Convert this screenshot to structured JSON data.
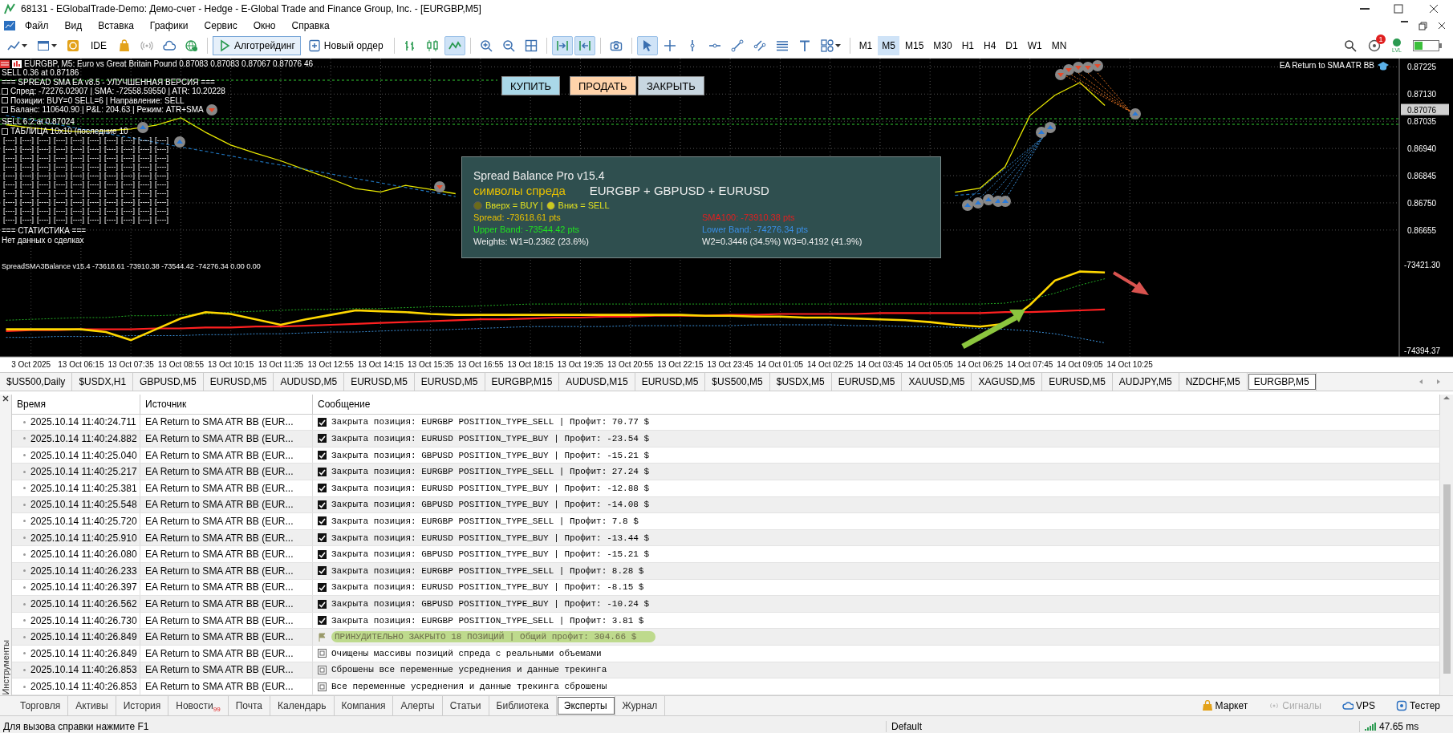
{
  "window": {
    "title": "68131 - EGlobalTrade-Demo: Демо-счет - Hedge - E-Global Trade and Finance Group, Inc. - [EURGBP,M5]"
  },
  "menu": [
    "Файл",
    "Вид",
    "Вставка",
    "Графики",
    "Сервис",
    "Окно",
    "Справка"
  ],
  "toolbar": {
    "ide": "IDE",
    "algo_trading": {
      "label": "Алготрейдинг",
      "on": true
    },
    "new_order": "Новый ордер",
    "tools": [
      {
        "selected": false
      },
      {
        "selected": false
      },
      {
        "selected": false
      },
      {
        "selected": false
      },
      {
        "selected": false
      },
      {
        "selected": false
      },
      {
        "selected": false
      },
      {
        "selected": false
      },
      {
        "selected": false
      },
      {
        "selected": true
      },
      {
        "selected": false
      },
      {
        "selected": false
      },
      {
        "selected": false
      },
      {
        "selected": true
      },
      {
        "selected": true
      },
      {
        "selected": false
      },
      {
        "selected": true
      },
      {
        "selected": false
      },
      {
        "selected": false
      },
      {
        "selected": false
      },
      {
        "selected": false
      },
      {
        "selected": false
      },
      {
        "selected": false
      },
      {
        "selected": false
      },
      {
        "selected": false
      }
    ],
    "timeframes": [
      {
        "label": "M1",
        "selected": false
      },
      {
        "label": "M5",
        "selected": true
      },
      {
        "label": "M15",
        "selected": false
      },
      {
        "label": "M30",
        "selected": false
      },
      {
        "label": "H1",
        "selected": false
      },
      {
        "label": "H4",
        "selected": false
      },
      {
        "label": "D1",
        "selected": false
      },
      {
        "label": "W1",
        "selected": false
      },
      {
        "label": "MN",
        "selected": false
      }
    ],
    "notification_badge": "1",
    "level_label": "LVL"
  },
  "chart": {
    "header": "EURGBP, M5:  Euro vs Great Britain Pound  0.87083 0.87083 0.87067 0.87076  46",
    "info_lines": [
      {
        "kind": "plain",
        "text": "SELL 0.36 at 0.87186"
      },
      {
        "kind": "plain",
        "text": "=== SPREAD SMA EA v8.5 - УЛУЧШЕННАЯ ВЕРСИЯ ==="
      },
      {
        "kind": "bullet",
        "text": "Спред: -72276.02907 | SMA: -72558.59550 | ATR: 10.20228"
      },
      {
        "kind": "bullet",
        "text": "Позиции: BUY=0 SELL=6 | Направление: SELL"
      },
      {
        "kind": "bullet",
        "text": "Баланс: 110640.90 | P&L: 204.63 | Режим: ATR+SMA"
      }
    ],
    "sell_label": "SELL 6.2 at 0.87024",
    "table_title": "ТАБЛИЦА 10x10 (последние 10",
    "table_rows": [
      [
        "[----]",
        "[----]",
        "[----]",
        "[----]",
        "[----]",
        "[----]",
        "[----]",
        "[----]",
        "[----]",
        "[----]"
      ],
      [
        "[----]",
        "[----]",
        "[----]",
        "[----]",
        "[----]",
        "[----]",
        "[----]",
        "[----]",
        "[----]",
        "[----]"
      ],
      [
        "[----]",
        "[----]",
        "[----]",
        "[----]",
        "[----]",
        "[----]",
        "[----]",
        "[----]",
        "[----]",
        "[----]"
      ],
      [
        "[----]",
        "[----]",
        "[----]",
        "[----]",
        "[----]",
        "[----]",
        "[----]",
        "[----]",
        "[----]",
        "[----]"
      ],
      [
        "[----]",
        "[----]",
        "[----]",
        "[----]",
        "[----]",
        "[----]",
        "[----]",
        "[----]",
        "[----]",
        "[----]"
      ],
      [
        "[----]",
        "[----]",
        "[----]",
        "[----]",
        "[----]",
        "[----]",
        "[----]",
        "[----]",
        "[----]",
        "[----]"
      ],
      [
        "[----]",
        "[----]",
        "[----]",
        "[----]",
        "[----]",
        "[----]",
        "[----]",
        "[----]",
        "[----]",
        "[----]"
      ],
      [
        "[----]",
        "[----]",
        "[----]",
        "[----]",
        "[----]",
        "[----]",
        "[----]",
        "[----]",
        "[----]",
        "[----]"
      ],
      [
        "[----]",
        "[----]",
        "[----]",
        "[----]",
        "[----]",
        "[----]",
        "[----]",
        "[----]",
        "[----]",
        "[----]"
      ],
      [
        "[----]",
        "[----]",
        "[----]",
        "[----]",
        "[----]",
        "[----]",
        "[----]",
        "[----]",
        "[----]",
        "[----]"
      ]
    ],
    "stats_title": "=== СТАТИСТИКА ===",
    "stats_text": "Нет данных о сделках",
    "buttons": [
      {
        "label": "КУПИТЬ",
        "kind": "buy"
      },
      {
        "label": "ПРОДАТЬ",
        "kind": "sell"
      },
      {
        "label": "ЗАКРЫТЬ",
        "kind": "close"
      }
    ],
    "expert_label": "EA Return to SMA ATR BB",
    "last_price": "0.87076",
    "chart_data": {
      "type": "line",
      "categories": [
        null,
        null,
        null,
        null,
        null,
        null,
        null,
        null,
        null,
        null,
        null,
        null,
        null,
        null,
        null,
        null,
        null,
        null,
        null,
        null,
        null,
        null,
        null,
        null,
        null,
        null,
        null,
        null,
        null,
        null,
        null,
        null,
        null,
        null,
        null,
        null,
        null,
        null,
        null,
        null,
        null,
        null,
        null,
        null,
        null,
        null,
        null,
        null,
        null,
        null,
        null,
        null,
        null,
        null,
        null,
        null
      ],
      "series": [
        {
          "color": "#e8e800",
          "values": [
            0.87023,
            0.87012,
            0.87004,
            0.86998,
            0.87002,
            0.87008,
            0.87021,
            0.87047,
            0.86996,
            0.86952,
            0.86923,
            0.86897,
            0.86865,
            0.86834,
            0.868,
            0.86788,
            0.86811,
            0.86797,
            0.86782,
            null,
            null,
            null,
            null,
            null,
            null,
            null,
            null,
            null,
            null,
            null,
            null,
            null,
            null,
            null,
            null,
            null,
            null,
            null,
            0.86787,
            0.86801,
            0.86876,
            0.87055,
            0.87126,
            0.8717,
            0.8709,
            null,
            null,
            null,
            null,
            null,
            null,
            null,
            null,
            null,
            null,
            null
          ]
        },
        {
          "color": "#1e6fb4",
          "line_style": "dashed",
          "values": [
            0.87055,
            0.8704,
            0.87025,
            0.87008,
            0.86993,
            0.86977,
            0.86961,
            0.86945,
            0.8693,
            0.86914,
            0.86897,
            0.86882,
            0.86867,
            0.86851,
            0.86835,
            0.8682,
            0.86804,
            0.86788,
            0.86772,
            null,
            null,
            null,
            null,
            null,
            null,
            null,
            null,
            null,
            null,
            null,
            null,
            null,
            null,
            null,
            null,
            null,
            null,
            null,
            0.86776,
            0.86782,
            null,
            null,
            null,
            null,
            null,
            null,
            null,
            null,
            null,
            null,
            null,
            null,
            null,
            null,
            null,
            null
          ]
        }
      ],
      "ylim": [
        0.86551,
        0.87254
      ],
      "grid": true,
      "yticks": [
        {
          "value": 0.87225,
          "label": "0.87225"
        },
        {
          "value": 0.8713,
          "label": "0.87130"
        },
        {
          "value": 0.87035,
          "label": "0.87035"
        },
        {
          "value": 0.8694,
          "label": "0.86940"
        },
        {
          "value": 0.86845,
          "label": "0.86845"
        },
        {
          "value": 0.8675,
          "label": "0.86750"
        },
        {
          "value": 0.86655,
          "label": "0.86655"
        }
      ]
    }
  },
  "panel": {
    "title": "Spread Balance Pro v15.4",
    "symbols_label": "символы спреда",
    "symbols": "EURGBP + GBPUSD + EURUSD",
    "legend": [
      {
        "text": "Вверх = BUY |",
        "color": "#6b6b1a"
      },
      {
        "text": "Вниз = SELL",
        "color": "#c8c820"
      }
    ],
    "rows": [
      [
        {
          "text": "Spread: -73618.61 pts",
          "color": "#e8c000"
        },
        {
          "text": "SMA100: -73910.38 pts",
          "color": "#e02020"
        }
      ],
      [
        {
          "text": "Upper Band: -73544.42 pts",
          "color": "#20e020"
        },
        {
          "text": "Lower Band: -74276.34 pts",
          "color": "#3a8fe8"
        }
      ],
      [
        {
          "text": "Weights: W1=0.2362 (23.6%)",
          "color": "#f0f0f0"
        },
        {
          "text": "W2=0.3446 (34.5%) W3=0.4192 (41.9%)",
          "color": "#f0f0f0"
        }
      ]
    ]
  },
  "indicator": {
    "header": "SpreadSMA3Balance v15.4 -73618.61 -73910.38 -73544.42 -74276.34 0.00 0.00",
    "chart_data": {
      "type": "line",
      "categories": [
        null,
        "3 Oct 2025",
        null,
        "13 Oct 06:15",
        null,
        "13 Oct 07:35",
        null,
        "13 Oct 08:55",
        null,
        "13 Oct 10:15",
        null,
        "13 Oct 11:35",
        null,
        "13 Oct 12:55",
        null,
        "13 Oct 14:15",
        null,
        "13 Oct 15:35",
        null,
        "13 Oct 16:55",
        null,
        "13 Oct 18:15",
        null,
        "13 Oct 19:35",
        null,
        "13 Oct 20:55",
        null,
        "13 Oct 22:15",
        null,
        "13 Oct 23:45",
        null,
        "14 Oct 01:05",
        null,
        "14 Oct 02:25",
        null,
        "14 Oct 03:45",
        null,
        "14 Oct 05:05",
        null,
        "14 Oct 06:25",
        null,
        "14 Oct 07:45",
        null,
        "14 Oct 09:05",
        null,
        "14 Oct 10:25",
        null,
        null,
        null,
        null,
        null,
        null,
        null,
        null,
        null,
        null
      ],
      "series": [
        {
          "color": "#ffd700",
          "values": [
            -74160,
            -74160,
            -74160,
            -74160,
            -74190,
            -74280,
            -74160,
            -74040,
            -73970,
            -73990,
            -74050,
            -74110,
            -74050,
            -74000,
            -73950,
            -73960,
            -73970,
            -73990,
            -74000,
            -74000,
            -74000,
            -74000,
            -74000,
            -74000,
            -74000,
            -74000,
            -74000,
            -74000,
            -74010,
            -74010,
            -74020,
            -74020,
            -74030,
            -74030,
            -74040,
            -74050,
            -74060,
            -74080,
            -74110,
            -74130,
            -74100,
            -73890,
            -73620,
            -73520,
            -73530,
            null,
            null,
            null,
            null,
            null,
            null,
            null,
            null,
            null,
            null,
            null
          ]
        },
        {
          "color": "#ff2020",
          "values": [
            -74180,
            -74170,
            -74170,
            -74160,
            -74160,
            -74160,
            -74150,
            -74150,
            -74140,
            -74140,
            -74130,
            -74130,
            -74120,
            -74110,
            -74100,
            -74090,
            -74080,
            -74070,
            -74060,
            -74050,
            -74050,
            -74040,
            -74030,
            -74030,
            -74020,
            -74020,
            -74010,
            -74010,
            -74010,
            -74000,
            -74000,
            -73990,
            -73990,
            -73990,
            -73990,
            -73980,
            -73980,
            -73980,
            -73980,
            -73980,
            -73970,
            -73970,
            -73960,
            -73950,
            -73940,
            null,
            null,
            null,
            null,
            null,
            null,
            null,
            null,
            null,
            null,
            null
          ]
        },
        {
          "color": "#22aa22",
          "line_style": "dotted",
          "values": [
            -74060,
            -74050,
            -74040,
            -74030,
            -74030,
            -74010,
            -74010,
            -74000,
            -73990,
            -73970,
            -73960,
            -73950,
            -73940,
            -73940,
            -73930,
            -73930,
            -73920,
            -73910,
            -73910,
            -73900,
            -73890,
            -73880,
            -73880,
            -73880,
            -73880,
            -73880,
            -73880,
            -73880,
            -73880,
            -73880,
            -73880,
            -73880,
            -73880,
            -73880,
            -73880,
            -73880,
            -73880,
            -73880,
            -73880,
            -73880,
            -73870,
            -73830,
            -73760,
            -73670,
            -73600,
            null,
            null,
            null,
            null,
            null,
            null,
            null,
            null,
            null,
            null,
            null
          ]
        },
        {
          "color": "#3a8fd8",
          "line_style": "dotted",
          "values": [
            -74250,
            -74250,
            -74240,
            -74240,
            -74240,
            -74230,
            -74230,
            -74230,
            -74220,
            -74220,
            -74210,
            -74210,
            -74200,
            -74190,
            -74190,
            -74180,
            -74170,
            -74170,
            -74160,
            -74150,
            -74140,
            -74130,
            -74130,
            -74130,
            -74130,
            -74120,
            -74120,
            -74120,
            -74120,
            -74120,
            -74110,
            -74110,
            -74110,
            -74110,
            -74120,
            -74120,
            -74130,
            -74130,
            -74140,
            -74150,
            -74160,
            -74180,
            -74210,
            -74260,
            -74310,
            null,
            null,
            null,
            null,
            null,
            null,
            null,
            null,
            null,
            null,
            null
          ]
        }
      ],
      "ylim": [
        -74466,
        -73390
      ],
      "grid": true,
      "yticks": [
        {
          "value": -73421.3,
          "label": "-73421.30"
        },
        {
          "value": -74394.37,
          "label": "-74394.37"
        }
      ]
    }
  },
  "chart_tabs": [
    {
      "label": "$US500,Daily",
      "selected": false
    },
    {
      "label": "$USDX,H1",
      "selected": false
    },
    {
      "label": "GBPUSD,M5",
      "selected": false
    },
    {
      "label": "EURUSD,M5",
      "selected": false
    },
    {
      "label": "AUDUSD,M5",
      "selected": false
    },
    {
      "label": "EURUSD,M5",
      "selected": false
    },
    {
      "label": "EURUSD,M5",
      "selected": false
    },
    {
      "label": "EURGBP,M15",
      "selected": false
    },
    {
      "label": "AUDUSD,M15",
      "selected": false
    },
    {
      "label": "EURUSD,M5",
      "selected": false
    },
    {
      "label": "$US500,M5",
      "selected": false
    },
    {
      "label": "$USDX,M5",
      "selected": false
    },
    {
      "label": "EURUSD,M5",
      "selected": false
    },
    {
      "label": "XAUUSD,M5",
      "selected": false
    },
    {
      "label": "XAGUSD,M5",
      "selected": false
    },
    {
      "label": "EURUSD,M5",
      "selected": false
    },
    {
      "label": "AUDJPY,M5",
      "selected": false
    },
    {
      "label": "NZDCHF,M5",
      "selected": false
    },
    {
      "label": "EURGBP,M5",
      "selected": true
    }
  ],
  "log": {
    "columns": [
      "Время",
      "Источник",
      "Сообщение"
    ],
    "rows": [
      {
        "time": "2025.10.14 11:40:24.711",
        "source": "EA Return to SMA ATR BB (EUR...",
        "kind": "closed",
        "message": "Закрыта позиция: EURGBP POSITION_TYPE_SELL | Профит: 70.77 $"
      },
      {
        "time": "2025.10.14 11:40:24.882",
        "source": "EA Return to SMA ATR BB (EUR...",
        "kind": "closed",
        "message": "Закрыта позиция: EURUSD POSITION_TYPE_BUY | Профит: -23.54 $"
      },
      {
        "time": "2025.10.14 11:40:25.040",
        "source": "EA Return to SMA ATR BB (EUR...",
        "kind": "closed",
        "message": "Закрыта позиция: GBPUSD POSITION_TYPE_BUY | Профит: -15.21 $"
      },
      {
        "time": "2025.10.14 11:40:25.217",
        "source": "EA Return to SMA ATR BB (EUR...",
        "kind": "closed",
        "message": "Закрыта позиция: EURGBP POSITION_TYPE_SELL | Профит: 27.24 $"
      },
      {
        "time": "2025.10.14 11:40:25.381",
        "source": "EA Return to SMA ATR BB (EUR...",
        "kind": "closed",
        "message": "Закрыта позиция: EURUSD POSITION_TYPE_BUY | Профит: -12.88 $"
      },
      {
        "time": "2025.10.14 11:40:25.548",
        "source": "EA Return to SMA ATR BB (EUR...",
        "kind": "closed",
        "message": "Закрыта позиция: GBPUSD POSITION_TYPE_BUY | Профит: -14.08 $"
      },
      {
        "time": "2025.10.14 11:40:25.720",
        "source": "EA Return to SMA ATR BB (EUR...",
        "kind": "closed",
        "message": "Закрыта позиция: EURGBP POSITION_TYPE_SELL | Профит: 7.8 $"
      },
      {
        "time": "2025.10.14 11:40:25.910",
        "source": "EA Return to SMA ATR BB (EUR...",
        "kind": "closed",
        "message": "Закрыта позиция: EURUSD POSITION_TYPE_BUY | Профит: -13.44 $"
      },
      {
        "time": "2025.10.14 11:40:26.080",
        "source": "EA Return to SMA ATR BB (EUR...",
        "kind": "closed",
        "message": "Закрыта позиция: GBPUSD POSITION_TYPE_BUY | Профит: -15.21 $"
      },
      {
        "time": "2025.10.14 11:40:26.233",
        "source": "EA Return to SMA ATR BB (EUR...",
        "kind": "closed",
        "message": "Закрыта позиция: EURGBP POSITION_TYPE_SELL | Профит: 8.28 $"
      },
      {
        "time": "2025.10.14 11:40:26.397",
        "source": "EA Return to SMA ATR BB (EUR...",
        "kind": "closed",
        "message": "Закрыта позиция: EURUSD POSITION_TYPE_BUY | Профит: -8.15 $"
      },
      {
        "time": "2025.10.14 11:40:26.562",
        "source": "EA Return to SMA ATR BB (EUR...",
        "kind": "closed",
        "message": "Закрыта позиция: GBPUSD POSITION_TYPE_BUY | Профит: -10.24 $"
      },
      {
        "time": "2025.10.14 11:40:26.730",
        "source": "EA Return to SMA ATR BB (EUR...",
        "kind": "closed",
        "message": "Закрыта позиция: EURGBP POSITION_TYPE_SELL | Профит: 3.81 $"
      },
      {
        "time": "2025.10.14 11:40:26.849",
        "source": "EA Return to SMA ATR BB (EUR...",
        "kind": "summary",
        "message": "ПРИНУДИТЕЛЬНО ЗАКРЫТО 18 ПОЗИЦИЙ | Общий профит: 304.66 $"
      },
      {
        "time": "2025.10.14 11:40:26.849",
        "source": "EA Return to SMA ATR BB (EUR...",
        "kind": "info",
        "message": "Очищены массивы позиций спреда с реальными объемами"
      },
      {
        "time": "2025.10.14 11:40:26.853",
        "source": "EA Return to SMA ATR BB (EUR...",
        "kind": "info",
        "message": "Сброшены все переменные усреднения и данные трекинга"
      },
      {
        "time": "2025.10.14 11:40:26.853",
        "source": "EA Return to SMA ATR BB (EUR...",
        "kind": "info",
        "message": "Все переменные усреднения и данные трекинга сброшены"
      }
    ]
  },
  "sidebar_label": "Инструменты",
  "bottom_tabs": [
    {
      "label": "Торговля",
      "selected": false
    },
    {
      "label": "Активы",
      "selected": false
    },
    {
      "label": "История",
      "selected": false
    },
    {
      "label": "Новости",
      "selected": false,
      "badge": "99"
    },
    {
      "label": "Почта",
      "selected": false
    },
    {
      "label": "Календарь",
      "selected": false
    },
    {
      "label": "Компания",
      "selected": false
    },
    {
      "label": "Алерты",
      "selected": false
    },
    {
      "label": "Статьи",
      "selected": false
    },
    {
      "label": "Библиотека",
      "selected": false
    },
    {
      "label": "Эксперты",
      "selected": true
    },
    {
      "label": "Журнал",
      "selected": false
    }
  ],
  "services": [
    {
      "label": "Маркет",
      "disabled": false
    },
    {
      "label": "Сигналы",
      "disabled": true
    },
    {
      "label": "VPS",
      "disabled": false
    },
    {
      "label": "Тестер",
      "disabled": false
    }
  ],
  "status_bar": {
    "help": "Для вызова справки нажмите F1",
    "profile": "Default",
    "ping": "47.65 ms"
  }
}
